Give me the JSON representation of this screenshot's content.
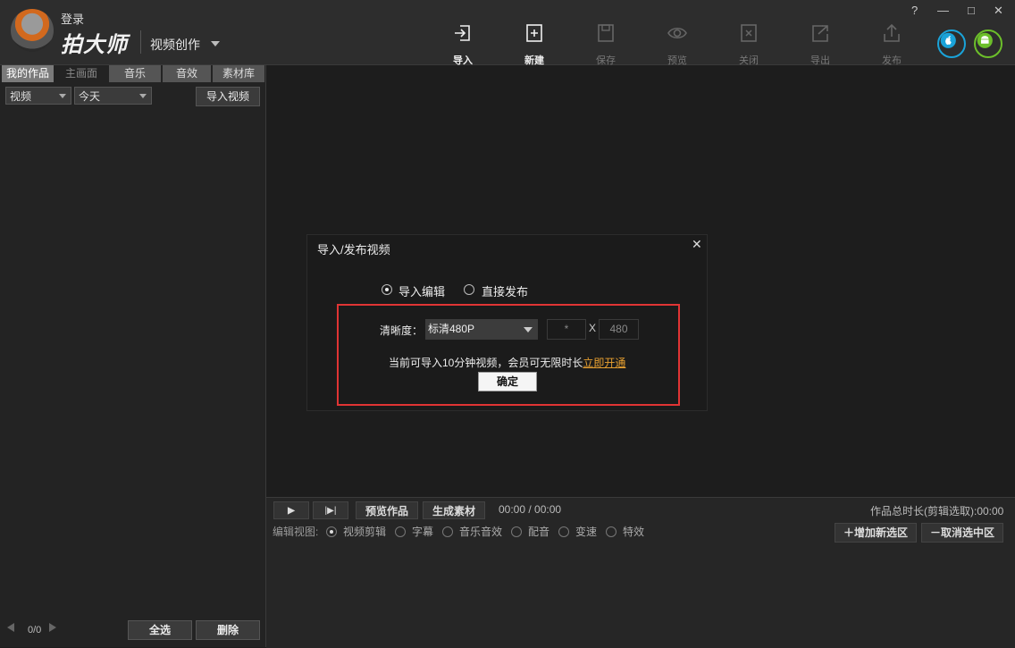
{
  "header": {
    "login": "登录",
    "app_name": "拍大师",
    "mode": "视频创作",
    "toolbar": [
      {
        "label": "导入",
        "icon": "import-icon",
        "active": true
      },
      {
        "label": "新建",
        "icon": "new-icon",
        "active": true
      },
      {
        "label": "保存",
        "icon": "save-icon",
        "active": false
      },
      {
        "label": "预览",
        "icon": "preview-eye-icon",
        "active": false
      },
      {
        "label": "关闭",
        "icon": "close-doc-icon",
        "active": false
      },
      {
        "label": "导出",
        "icon": "export-icon",
        "active": false
      },
      {
        "label": "发布",
        "icon": "publish-icon",
        "active": false
      }
    ],
    "window_buttons": [
      "?",
      "—",
      "□",
      "✕"
    ]
  },
  "left": {
    "tabs": [
      "我的作品",
      "主画面",
      "音乐",
      "音效",
      "素材库"
    ],
    "filter_type": "视频",
    "filter_date": "今天",
    "import_button": "导入视频",
    "pager": "0/0",
    "select_all": "全选",
    "delete": "删除"
  },
  "dialog": {
    "title": "导入/发布视频",
    "close": "✕",
    "options": [
      "导入编辑",
      "直接发布"
    ],
    "selected_option": "导入编辑",
    "resolution_label": "清晰度：",
    "resolution_value": "标清480P",
    "width_value": "*",
    "x_sep": "X",
    "height_value": "480",
    "notice": "当前可导入10分钟视频，会员可无限时长",
    "notice_link": "立即开通",
    "confirm": "确定"
  },
  "bottom": {
    "play": "▶",
    "step": "|▶|",
    "preview_work": "预览作品",
    "generate": "生成素材",
    "time": "00:00 / 00:00",
    "total_label": "作品总时长(剪辑选取):00:00",
    "edit_view_label": "编辑视图:",
    "views": [
      "视频剪辑",
      "字幕",
      "音乐音效",
      "配音",
      "变速",
      "特效"
    ],
    "selected_view": "视频剪辑",
    "add_selection": "增加新选区",
    "cancel_selection": "取消选中区"
  },
  "colors": {
    "accent_red": "#e03434",
    "link_orange": "#e8a030",
    "apple_blue": "#1aa3d9",
    "android_green": "#6cbf2a"
  }
}
